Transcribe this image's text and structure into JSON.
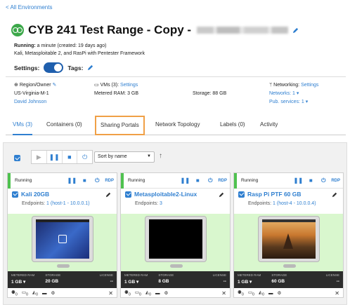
{
  "nav": {
    "back_label": "< All Environments"
  },
  "header": {
    "title": "CYB 241 Test Range - Copy -",
    "running_label": "Running:",
    "running_value": "a minute (created: 19 days ago)",
    "description": "Kali, Metasploitable 2, and RasPi with Pentester Framework",
    "settings_label": "Settings:",
    "tags_label": "Tags:"
  },
  "info": {
    "region_label": "Region/Owner",
    "region_value": "US-Virginia-M-1",
    "owner": "David Johnson",
    "vms_label": "VMs (3):",
    "vms_link": "Settings",
    "metered_ram": "Metered RAM: 3 GB",
    "storage": "Storage: 88 GB",
    "networking_label": "Networking:",
    "networking_link": "Settings",
    "networks": "Networks: 1 ▾",
    "pub_services": "Pub. services: 1 ▾"
  },
  "tabs": [
    {
      "label": "VMs (3)"
    },
    {
      "label": "Containers (0)"
    },
    {
      "label": "Sharing Portals"
    },
    {
      "label": "Network Topology"
    },
    {
      "label": "Labels (0)"
    },
    {
      "label": "Activity"
    }
  ],
  "toolbar": {
    "sort_value": "Sort by name",
    "sort_arrow": "↑"
  },
  "vms": [
    {
      "status": "Running",
      "name": "Kali 20GB",
      "endpoints_label": "Endpoints:",
      "endpoints_value": "1 (host-1 - 10.0.0.1)",
      "ram_label": "METERED RAM",
      "ram": "1 GB ▾",
      "storage_label": "STORAGE",
      "storage": "20 GB",
      "license_label": "LICENSE",
      "license": "--",
      "rdp": "RDP",
      "screen": "kali"
    },
    {
      "status": "Running",
      "name": "Metasploitable2-Linux",
      "endpoints_label": "Endpoints:",
      "endpoints_value": "3",
      "ram_label": "METERED RAM",
      "ram": "1 GB ▾",
      "storage_label": "STORAGE",
      "storage": "8 GB",
      "license_label": "LICENSE",
      "license": "--",
      "rdp": "RDP",
      "screen": "black"
    },
    {
      "status": "Running",
      "name": "Rasp Pi PTF 60 GB",
      "endpoints_label": "Endpoints:",
      "endpoints_value": "1 (host-4 - 10.0.0.4)",
      "ram_label": "METERED RAM",
      "ram": "1 GB ▾",
      "storage_label": "STORAGE",
      "storage": "60 GB",
      "license_label": "LICENSE",
      "license": "--",
      "rdp": "RDP",
      "screen": "sunset"
    }
  ],
  "card_footer": {
    "count": "0"
  },
  "colors": {
    "accent": "#2f7fd0",
    "running": "#4fc24f",
    "highlight": "#f0a046",
    "screen_bg": "#d9f7ce"
  }
}
